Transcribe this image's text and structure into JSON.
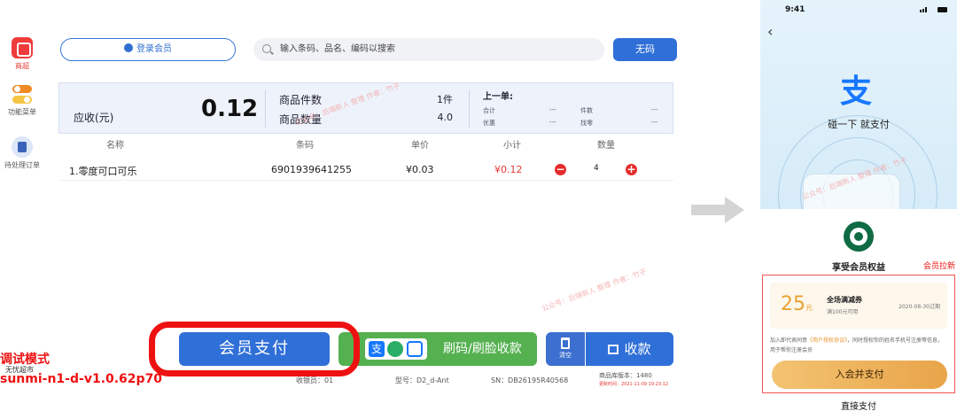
{
  "sidebar": {
    "items": [
      {
        "label": "商超",
        "icon": "store-icon"
      },
      {
        "label": "功能菜单",
        "icon": "toggle-icon"
      },
      {
        "label": "待处理订单",
        "icon": "orders-icon"
      }
    ]
  },
  "topbar": {
    "member_login": "登录会员",
    "search_placeholder": "输入条码、品名、编码以搜索",
    "no_code": "无码"
  },
  "summary": {
    "receivable_label": "应收(元)",
    "receivable_amount": "0.12",
    "item_types_label": "商品件数",
    "item_types_value": "1件",
    "item_qty_label": "商品数量",
    "item_qty_value": "4.0",
    "last_order": {
      "title": "上一单:",
      "total_label": "合计",
      "total_value": "---",
      "count_label": "件数",
      "count_value": "---",
      "discount_label": "优惠",
      "discount_value": "---",
      "change_label": "找零",
      "change_value": "---"
    }
  },
  "table": {
    "headers": [
      "名称",
      "条码",
      "单价",
      "小计",
      "数量"
    ],
    "rows": [
      {
        "name": "1.零度可口可乐",
        "barcode": "6901939641255",
        "price": "¥0.03",
        "subtotal": "¥0.12",
        "qty": "4"
      }
    ]
  },
  "buttons": {
    "member_pay": "会员支付",
    "scan_pay": "刷码/刷脸收款",
    "clear": "清空",
    "collect": "收款"
  },
  "debug": {
    "mode": "调试模式",
    "version": "sunmi-n1-d-v1.0.62p70",
    "shop": "无忧超市"
  },
  "statusbar": {
    "cashier": "收银员：01",
    "model": "型号：D2_d-Ant",
    "sn": "SN：DB26195R40568",
    "db_version": "商品库版本：1480",
    "update_time": "更新时间：2021-11-09 19:23:12"
  },
  "watermark": "公众号：后端新人 整理\n作者：竹子",
  "phone": {
    "time": "9:41",
    "alipay_glyph": "支",
    "tap_text": "碰一下  就支付",
    "benefit_title": "享受会员权益",
    "member_pull": "会员拉新",
    "coupon": {
      "amount": "25",
      "unit": "元",
      "name": "全场满减券",
      "condition": "满100元可用",
      "date": "2020-08-30过期"
    },
    "agreement_pre": "加入即代表同意",
    "agreement_link": "《用户授权协议》",
    "agreement_post": "，同时授权你的姓名手机号注册等信息，用于帮你注册会员",
    "join_button": "入会并支付",
    "direct_pay": "直接支付"
  },
  "colors": {
    "primary_blue": "#2f6fd8",
    "green": "#55b150",
    "red_highlight": "#ee1111",
    "gold": "#e9a449"
  }
}
